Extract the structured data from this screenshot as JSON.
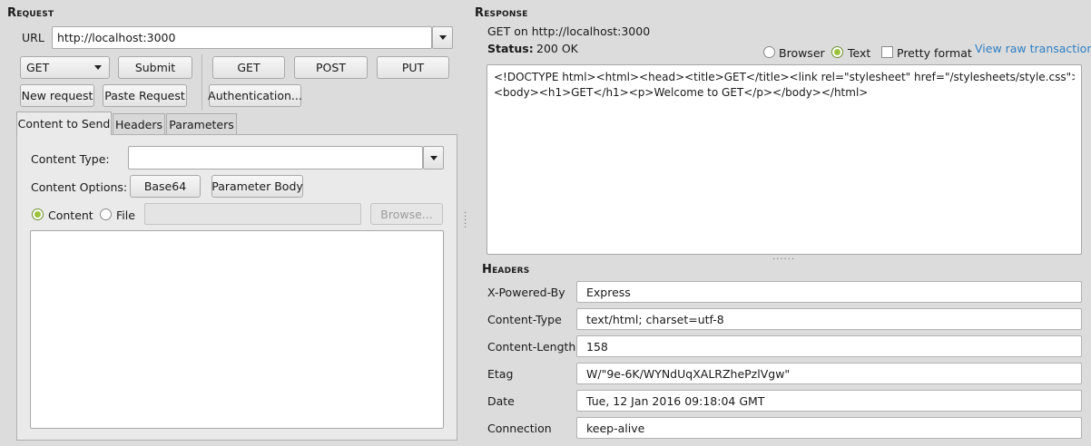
{
  "request": {
    "title": "Request",
    "url_label": "URL",
    "url_value": "http://localhost:3000",
    "method_selected": "GET",
    "submit_label": "Submit",
    "get_label": "GET",
    "post_label": "POST",
    "put_label": "PUT",
    "new_request_label": "New request",
    "paste_request_label": "Paste Request",
    "authentication_label": "Authentication...",
    "tabs": [
      "Content to Send",
      "Headers",
      "Parameters"
    ],
    "content_type_label": "Content Type:",
    "content_type_value": "",
    "content_options_label": "Content Options:",
    "base64_label": "Base64",
    "parameter_body_label": "Parameter Body",
    "content_radio_label": "Content",
    "file_radio_label": "File",
    "browse_label": "Browse..."
  },
  "response": {
    "title": "Response",
    "summary": "GET on http://localhost:3000",
    "status_label": "Status:",
    "status_value": "200 OK",
    "browser_label": "Browser",
    "text_label": "Text",
    "pretty_label": "Pretty format",
    "raw_link": "View raw transaction",
    "body_line1": "<!DOCTYPE html><html><head><title>GET</title><link rel=\"stylesheet\" href=\"/stylesheets/style.css\"></head>",
    "body_line2": "<body><h1>GET</h1><p>Welcome to GET</p></body></html>",
    "headers_title": "Headers",
    "headers": [
      {
        "name": "X-Powered-By",
        "value": "Express"
      },
      {
        "name": "Content-Type",
        "value": "text/html; charset=utf-8"
      },
      {
        "name": "Content-Length",
        "value": "158"
      },
      {
        "name": "Etag",
        "value": "W/\"9e-6K/WYNdUqXALRZhePzlVgw\""
      },
      {
        "name": "Date",
        "value": "Tue, 12 Jan 2016 09:18:04 GMT"
      },
      {
        "name": "Connection",
        "value": "keep-alive"
      }
    ]
  },
  "colors": {
    "background": "#dcdcdc",
    "radio_accent": "#9cc23c",
    "link": "#2f7fc4"
  }
}
